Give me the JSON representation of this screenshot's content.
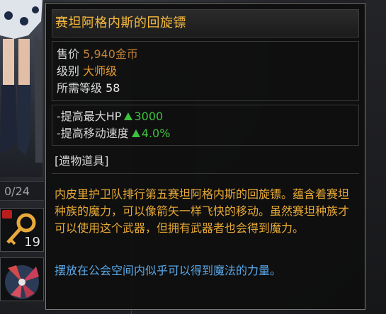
{
  "inventory": {
    "slot_counter": "0/24",
    "key_count": "19"
  },
  "tooltip": {
    "title": "赛坦阿格内斯的回旋镖",
    "price_label": "售价",
    "price_value": "5,940金币",
    "grade_label": "级别",
    "grade_value": "大师级",
    "level_label": "所需等级",
    "level_value": "58",
    "stats": [
      {
        "label": "-提高最大HP",
        "value": "3000"
      },
      {
        "label": "-提高移动速度",
        "value": "4.0%"
      }
    ],
    "item_type": "[遗物道具]",
    "description": "内皮里护卫队排行第五赛坦阿格内斯的回旋镖。蕴含着赛坦种族的魔力，可以像箭矢一样飞快的移动。虽然赛坦种族才可以使用这个武器，但拥有武器者也会得到魔力。",
    "lore": "摆放在公会空间内似乎可以得到魔法的力量。",
    "colors": {
      "title": "#f6b93c",
      "stat_up": "#3ec13e",
      "description": "#e6a836",
      "lore": "#59a8e8"
    }
  }
}
